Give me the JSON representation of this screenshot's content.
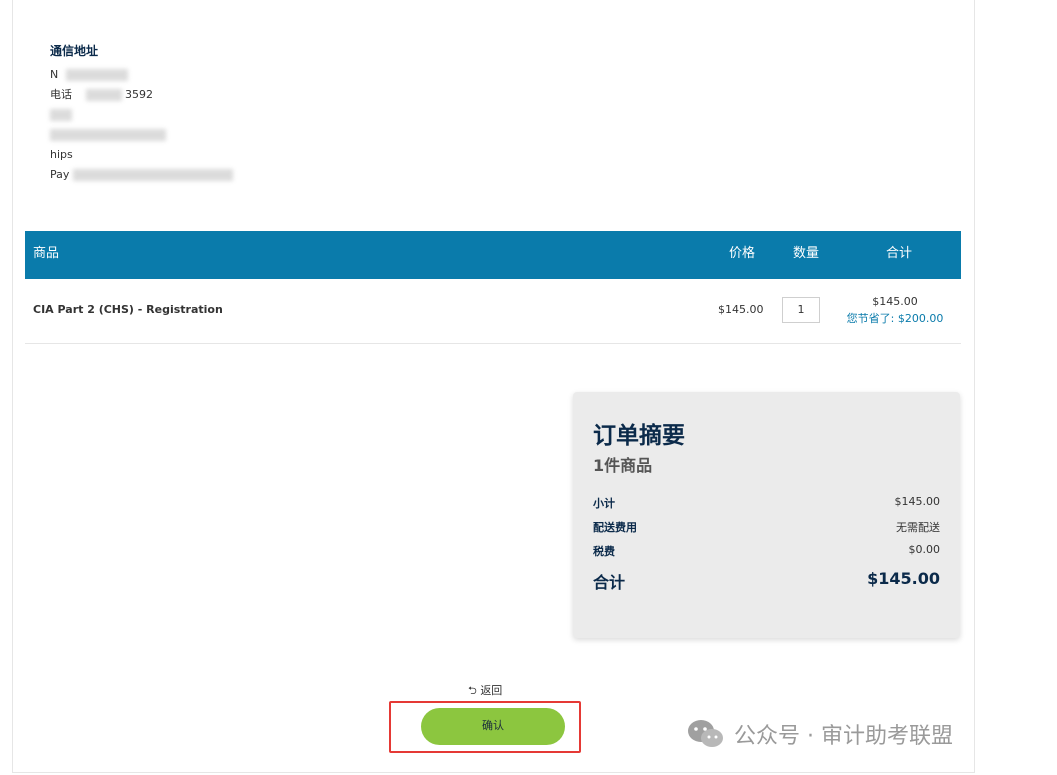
{
  "address": {
    "title": "通信地址",
    "lines": [
      "N",
      "电话",
      "",
      "",
      "hips",
      "Pay"
    ],
    "partial_phone": "3592"
  },
  "table": {
    "headers": {
      "product": "商品",
      "price": "价格",
      "quantity": "数量",
      "total": "合计"
    },
    "rows": [
      {
        "product": "CIA Part 2 (CHS) - Registration",
        "price": "$145.00",
        "quantity": "1",
        "total": "$145.00",
        "saved_label": "您节省了:",
        "saved_amount": "$200.00"
      }
    ]
  },
  "summary": {
    "title": "订单摘要",
    "item_count": "1件商品",
    "subtotal_label": "小计",
    "subtotal_value": "$145.00",
    "shipping_label": "配送费用",
    "shipping_value": "无需配送",
    "tax_label": "税费",
    "tax_value": "$0.00",
    "total_label": "合计",
    "total_value": "$145.00"
  },
  "actions": {
    "back_label": "返回",
    "confirm_label": "确认"
  },
  "watermark": {
    "text": "公众号 · 审计助考联盟",
    "icon": "wechat-icon"
  },
  "colors": {
    "table_header": "#0a7bab",
    "confirm_button": "#8cc63f",
    "highlight": "#e53935"
  }
}
